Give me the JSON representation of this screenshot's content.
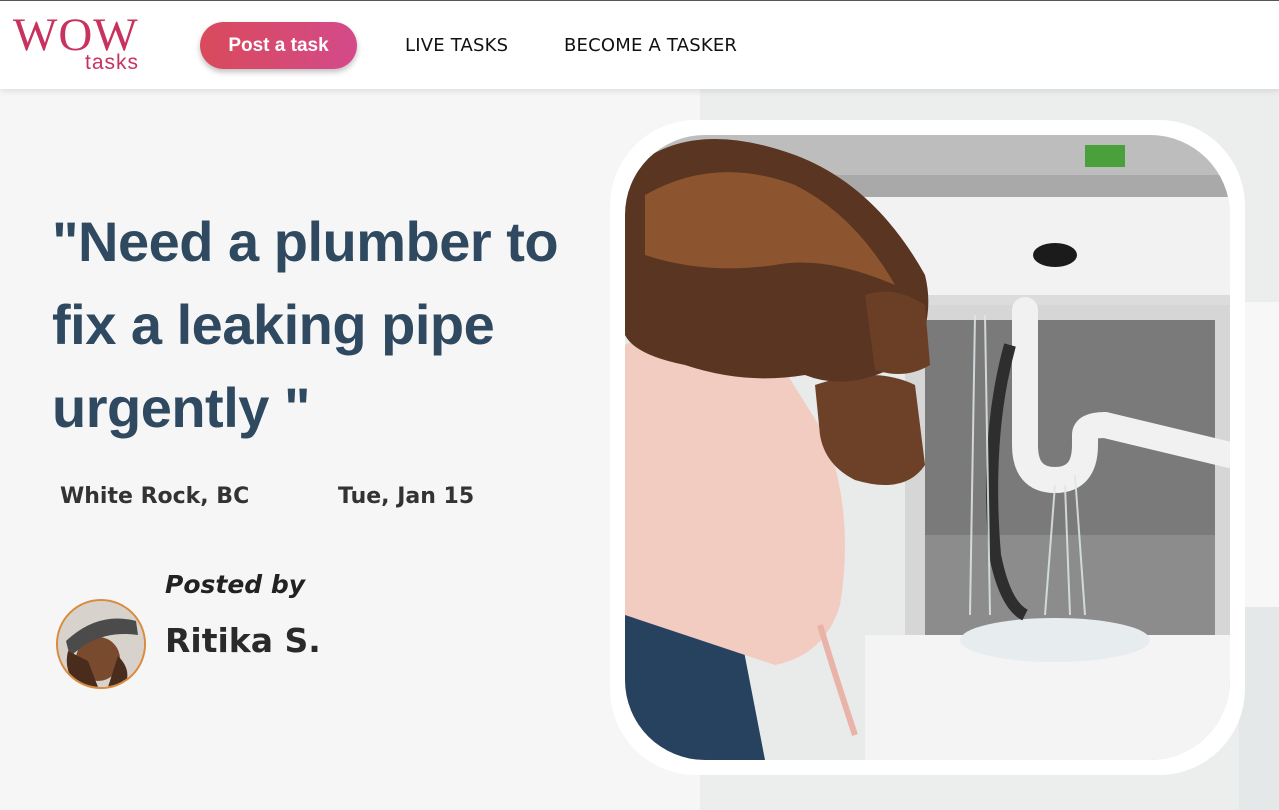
{
  "header": {
    "logo": {
      "brand": "WOW",
      "sub": "tasks"
    },
    "post_task_label": "Post a task",
    "nav": {
      "live_tasks": "LIVE TASKS",
      "become_tasker": "BECOME A TASKER"
    }
  },
  "task": {
    "title": "\"Need a plumber to fix a leaking pipe urgently \"",
    "location": "White Rock, BC",
    "date": "Tue, Jan 15",
    "posted_by_label": "Posted by",
    "poster_name": "Ritika S."
  },
  "colors": {
    "brand": "#c8325e",
    "post_button_gradient": [
      "#d94a5b",
      "#d44a8a"
    ],
    "headline": "#2f4a60"
  },
  "icons": {
    "hero_image": "woman-under-leaking-sink-photo",
    "avatar": "user-avatar-photo"
  }
}
